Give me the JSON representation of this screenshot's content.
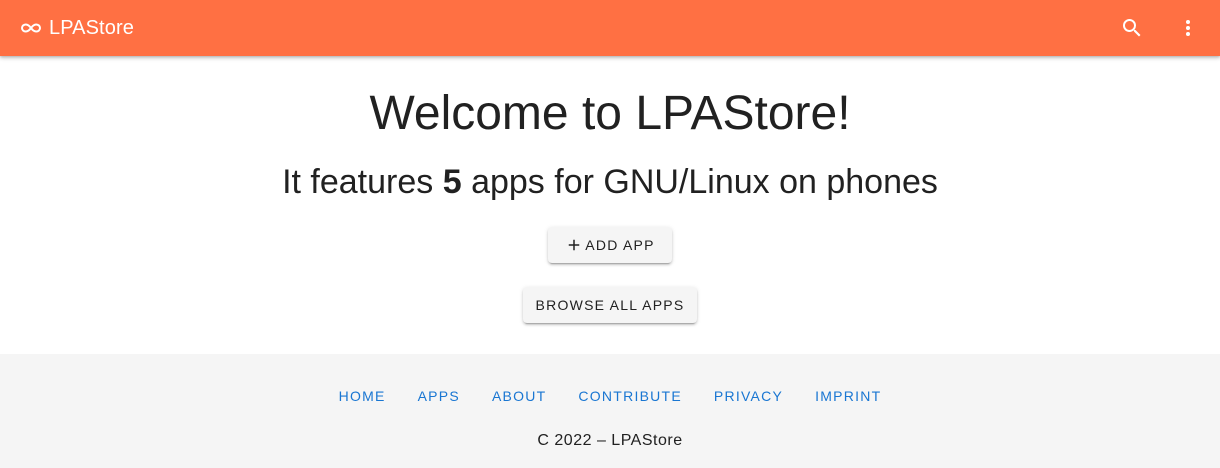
{
  "header": {
    "app_name": "LPAStore",
    "logo_icon": "infinity-icon",
    "search_icon": "search-icon",
    "menu_icon": "dots-vertical-icon",
    "background_color": "#ff7043"
  },
  "main": {
    "welcome_title": "Welcome to LPAStore!",
    "features_prefix": "It features ",
    "app_count": "5",
    "features_suffix": " apps for GNU/Linux on phones",
    "add_app_label": "ADD APP",
    "add_app_icon": "plus-icon",
    "browse_label": "BROWSE ALL APPS"
  },
  "footer": {
    "links": [
      {
        "label": "HOME"
      },
      {
        "label": "APPS"
      },
      {
        "label": "ABOUT"
      },
      {
        "label": "CONTRIBUTE"
      },
      {
        "label": "PRIVACY"
      },
      {
        "label": "IMPRINT"
      }
    ],
    "copyright": "C 2022 – LPAStore",
    "link_color": "#1976d2",
    "background_color": "#f5f5f5"
  }
}
